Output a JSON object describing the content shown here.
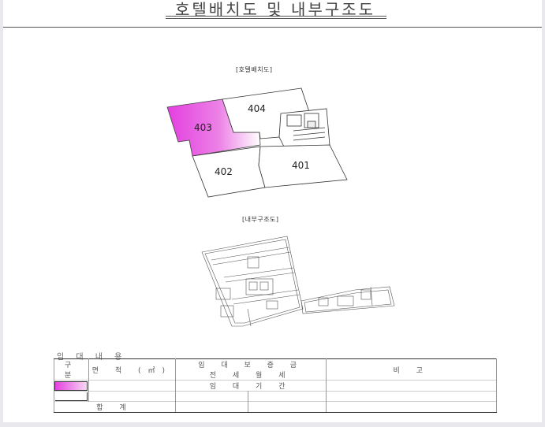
{
  "document": {
    "title": "호텔배치도 및 내부구조도"
  },
  "layout_plan": {
    "label": "[호텔배치도]",
    "rooms": [
      {
        "number": "403",
        "highlighted": true,
        "color": "#e43fe0"
      },
      {
        "number": "404",
        "highlighted": false
      },
      {
        "number": "402",
        "highlighted": false
      },
      {
        "number": "401",
        "highlighted": false
      }
    ]
  },
  "interior_plan": {
    "label": "[내부구조도]"
  },
  "notes": {
    "title": "임 대 내 용",
    "headers": {
      "category": "구 분",
      "area": "면 적 (㎡)",
      "rent_group": "임 대 보 증 금",
      "rent_sub": "전 세 월 세",
      "rent_sub2": "임 대 기 간",
      "remarks": "비 고"
    },
    "legend_color": "#e43fe0",
    "total_label": "합 계"
  }
}
